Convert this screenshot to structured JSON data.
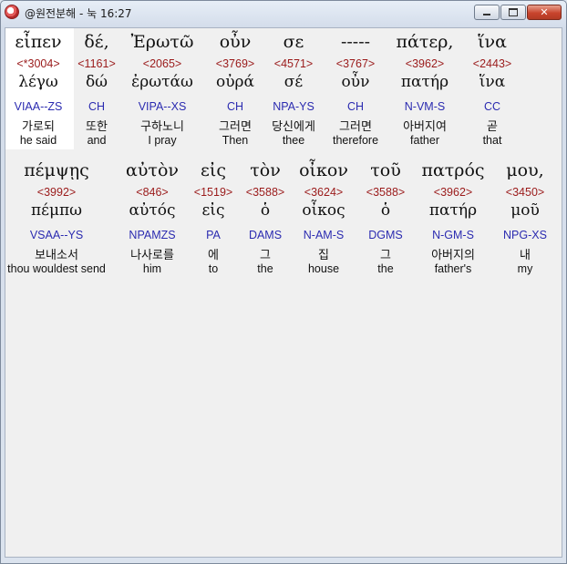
{
  "window": {
    "title": "@원전분해 - 눅 16:27",
    "controls": {
      "minimize": "minimize",
      "maximize": "maximize",
      "close": "✕"
    }
  },
  "verse_rows": [
    {
      "words": [
        {
          "greek": "εἶπεν",
          "strong": "<*3004>",
          "lemma": "λέγω",
          "parsing": "VIAA--ZS",
          "korean": "가로되",
          "english": "he said"
        },
        {
          "greek": "δέ,",
          "strong": "<1161>",
          "lemma": "δώ",
          "parsing": "CH",
          "korean": "또한",
          "english": "and"
        },
        {
          "greek": "Ἐρωτῶ",
          "strong": "<2065>",
          "lemma": "ἐρωτάω",
          "parsing": "VIPA--XS",
          "korean": "구하노니",
          "english": "I pray"
        },
        {
          "greek": "οὖν",
          "strong": "<3769>",
          "lemma": "οὐρά",
          "parsing": "CH",
          "korean": "그러면",
          "english": "Then"
        },
        {
          "greek": "σε",
          "strong": "<4571>",
          "lemma": "σέ",
          "parsing": "NPA-YS",
          "korean": "당신에게",
          "english": "thee"
        },
        {
          "greek": "-----",
          "strong": "<3767>",
          "lemma": "οὖν",
          "parsing": "CH",
          "korean": "그러면",
          "english": "therefore"
        },
        {
          "greek": "πάτερ,",
          "strong": "<3962>",
          "lemma": "πατήρ",
          "parsing": "N-VM-S",
          "korean": "아버지여",
          "english": "father"
        },
        {
          "greek": "ἵνα",
          "strong": "<2443>",
          "lemma": "ἵνα",
          "parsing": "CC",
          "korean": "곧",
          "english": "that"
        }
      ]
    },
    {
      "words": [
        {
          "greek": "πέμψῃς",
          "strong": "<3992>",
          "lemma": "πέμπω",
          "parsing": "VSAA--YS",
          "korean": "보내소서",
          "english": "thou wouldest send"
        },
        {
          "greek": "αὐτὸν",
          "strong": "<846>",
          "lemma": "αὐτός",
          "parsing": "NPAMZS",
          "korean": "나사로를",
          "english": "him"
        },
        {
          "greek": "εἰς",
          "strong": "<1519>",
          "lemma": "εἰς",
          "parsing": "PA",
          "korean": "에",
          "english": "to"
        },
        {
          "greek": "τὸν",
          "strong": "<3588>",
          "lemma": "ὁ",
          "parsing": "DAMS",
          "korean": "그",
          "english": "the"
        },
        {
          "greek": "οἶκον",
          "strong": "<3624>",
          "lemma": "οἶκος",
          "parsing": "N-AM-S",
          "korean": "집",
          "english": "house"
        },
        {
          "greek": "τοῦ",
          "strong": "<3588>",
          "lemma": "ὁ",
          "parsing": "DGMS",
          "korean": "그",
          "english": "the"
        },
        {
          "greek": "πατρός",
          "strong": "<3962>",
          "lemma": "πατήρ",
          "parsing": "N-GM-S",
          "korean": "아버지의",
          "english": "father's"
        },
        {
          "greek": "μου,",
          "strong": "<3450>",
          "lemma": "μοῦ",
          "parsing": "NPG-XS",
          "korean": "내",
          "english": "my"
        }
      ]
    }
  ],
  "colors": {
    "strong": "#9a1a1a",
    "parsing": "#2b2bb0",
    "text": "#111111",
    "selection": "#ffffff"
  }
}
